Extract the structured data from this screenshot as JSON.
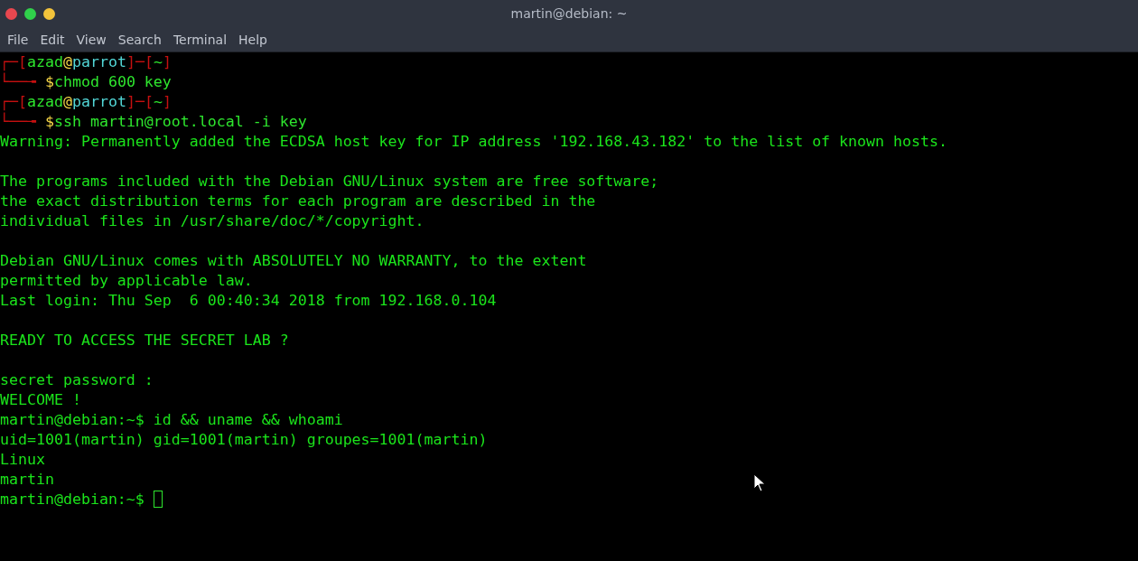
{
  "window": {
    "title": "martin@debian: ~"
  },
  "menu": [
    "File",
    "Edit",
    "View",
    "Search",
    "Terminal",
    "Help"
  ],
  "lines": [
    {
      "kind": "prompt_top",
      "corner": "┌─[",
      "user": "azad",
      "at": "@",
      "host": "parrot",
      "separator": "]─[",
      "dir": "~",
      "close": "]"
    },
    {
      "kind": "prompt_cmd",
      "arrow": "└──╼ ",
      "dollar": "$",
      "command": "chmod 600 key"
    },
    {
      "kind": "prompt_top",
      "corner": "┌─[",
      "user": "azad",
      "at": "@",
      "host": "parrot",
      "separator": "]─[",
      "dir": "~",
      "close": "]"
    },
    {
      "kind": "prompt_cmd",
      "arrow": "└──╼ ",
      "dollar": "$",
      "command": "ssh martin@root.local -i key"
    },
    {
      "kind": "output",
      "text": "Warning: Permanently added the ECDSA host key for IP address '192.168.43.182' to the list of known hosts."
    },
    {
      "kind": "blank"
    },
    {
      "kind": "output",
      "text": "The programs included with the Debian GNU/Linux system are free software;"
    },
    {
      "kind": "output",
      "text": "the exact distribution terms for each program are described in the"
    },
    {
      "kind": "output",
      "text": "individual files in /usr/share/doc/*/copyright."
    },
    {
      "kind": "blank"
    },
    {
      "kind": "output",
      "text": "Debian GNU/Linux comes with ABSOLUTELY NO WARRANTY, to the extent"
    },
    {
      "kind": "output",
      "text": "permitted by applicable law."
    },
    {
      "kind": "output",
      "text": "Last login: Thu Sep  6 00:40:34 2018 from 192.168.0.104"
    },
    {
      "kind": "blank"
    },
    {
      "kind": "output",
      "text": "READY TO ACCESS THE SECRET LAB ?"
    },
    {
      "kind": "blank"
    },
    {
      "kind": "output",
      "text": "secret password :"
    },
    {
      "kind": "output",
      "text": "WELCOME !"
    },
    {
      "kind": "shell",
      "prompt": "martin@debian:~$",
      "command": "id && uname && whoami"
    },
    {
      "kind": "output",
      "text": "uid=1001(martin) gid=1001(martin) groupes=1001(martin)"
    },
    {
      "kind": "output",
      "text": "Linux"
    },
    {
      "kind": "output",
      "text": "martin"
    },
    {
      "kind": "shell_input",
      "prompt": "martin@debian:~$"
    }
  ]
}
